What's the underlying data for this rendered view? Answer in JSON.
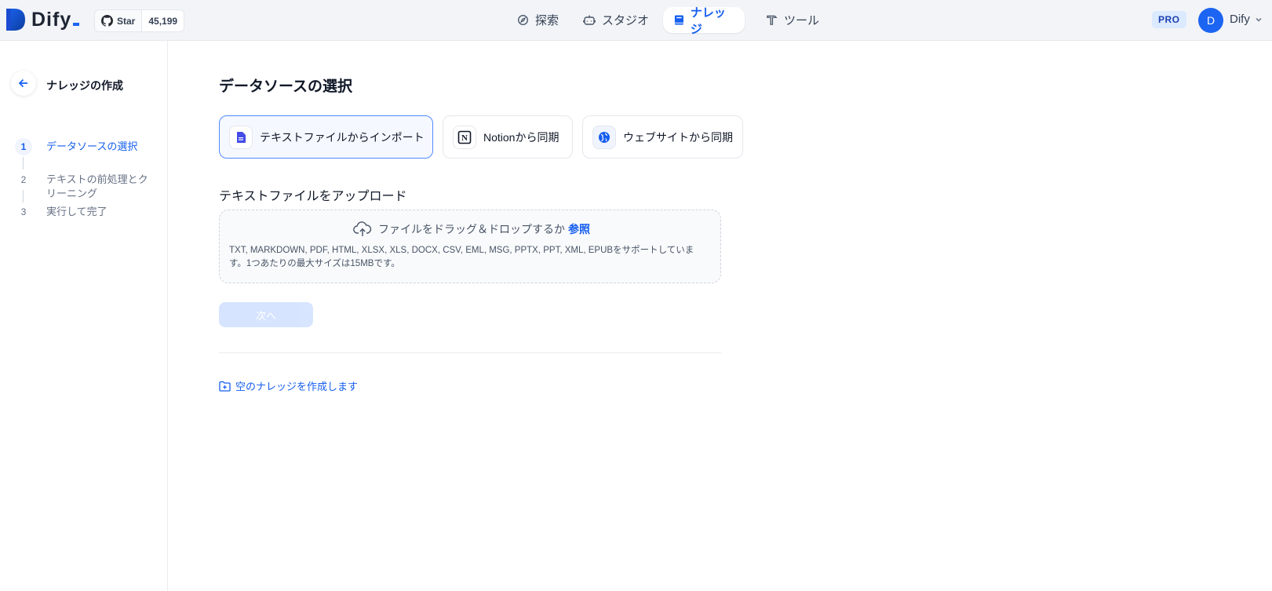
{
  "header": {
    "brand": "Dify",
    "github": {
      "star_label": "Star",
      "count": "45,199"
    },
    "nav": [
      {
        "label": "探索",
        "icon": "compass-icon",
        "active": false
      },
      {
        "label": "スタジオ",
        "icon": "robot-icon",
        "active": false
      },
      {
        "label": "ナレッジ",
        "icon": "book-icon",
        "active": true
      },
      {
        "label": "ツール",
        "icon": "hammer-icon",
        "active": false
      }
    ],
    "plan_badge": "PRO",
    "user": {
      "initial": "D",
      "name": "Dify"
    }
  },
  "sidebar": {
    "title": "ナレッジの作成",
    "steps": [
      {
        "num": "1",
        "label": "データソースの選択",
        "active": true
      },
      {
        "num": "2",
        "label": "テキストの前処理とクリーニング",
        "active": false
      },
      {
        "num": "3",
        "label": "実行して完了",
        "active": false
      }
    ]
  },
  "main": {
    "title": "データソースの選択",
    "sources": [
      {
        "label": "テキストファイルからインポート",
        "icon": "file-icon",
        "active": true
      },
      {
        "label": "Notionから同期",
        "icon": "notion-icon",
        "active": false
      },
      {
        "label": "ウェブサイトから同期",
        "icon": "globe-icon",
        "active": false
      }
    ],
    "upload_title": "テキストファイルをアップロード",
    "dropzone": {
      "prompt": "ファイルをドラッグ＆ドロップするか",
      "browse": "参照",
      "supported": "TXT, MARKDOWN, PDF, HTML, XLSX, XLS, DOCX, CSV, EML, MSG, PPTX, PPT, XML, EPUBをサポートしています。1つあたりの最大サイズは15MBです。"
    },
    "next_button": "次へ",
    "empty_link": "空のナレッジを作成します"
  },
  "colors": {
    "accent": "#155eef",
    "header_bg": "#f2f4f7",
    "disabled_button": "#d1e0ff"
  }
}
